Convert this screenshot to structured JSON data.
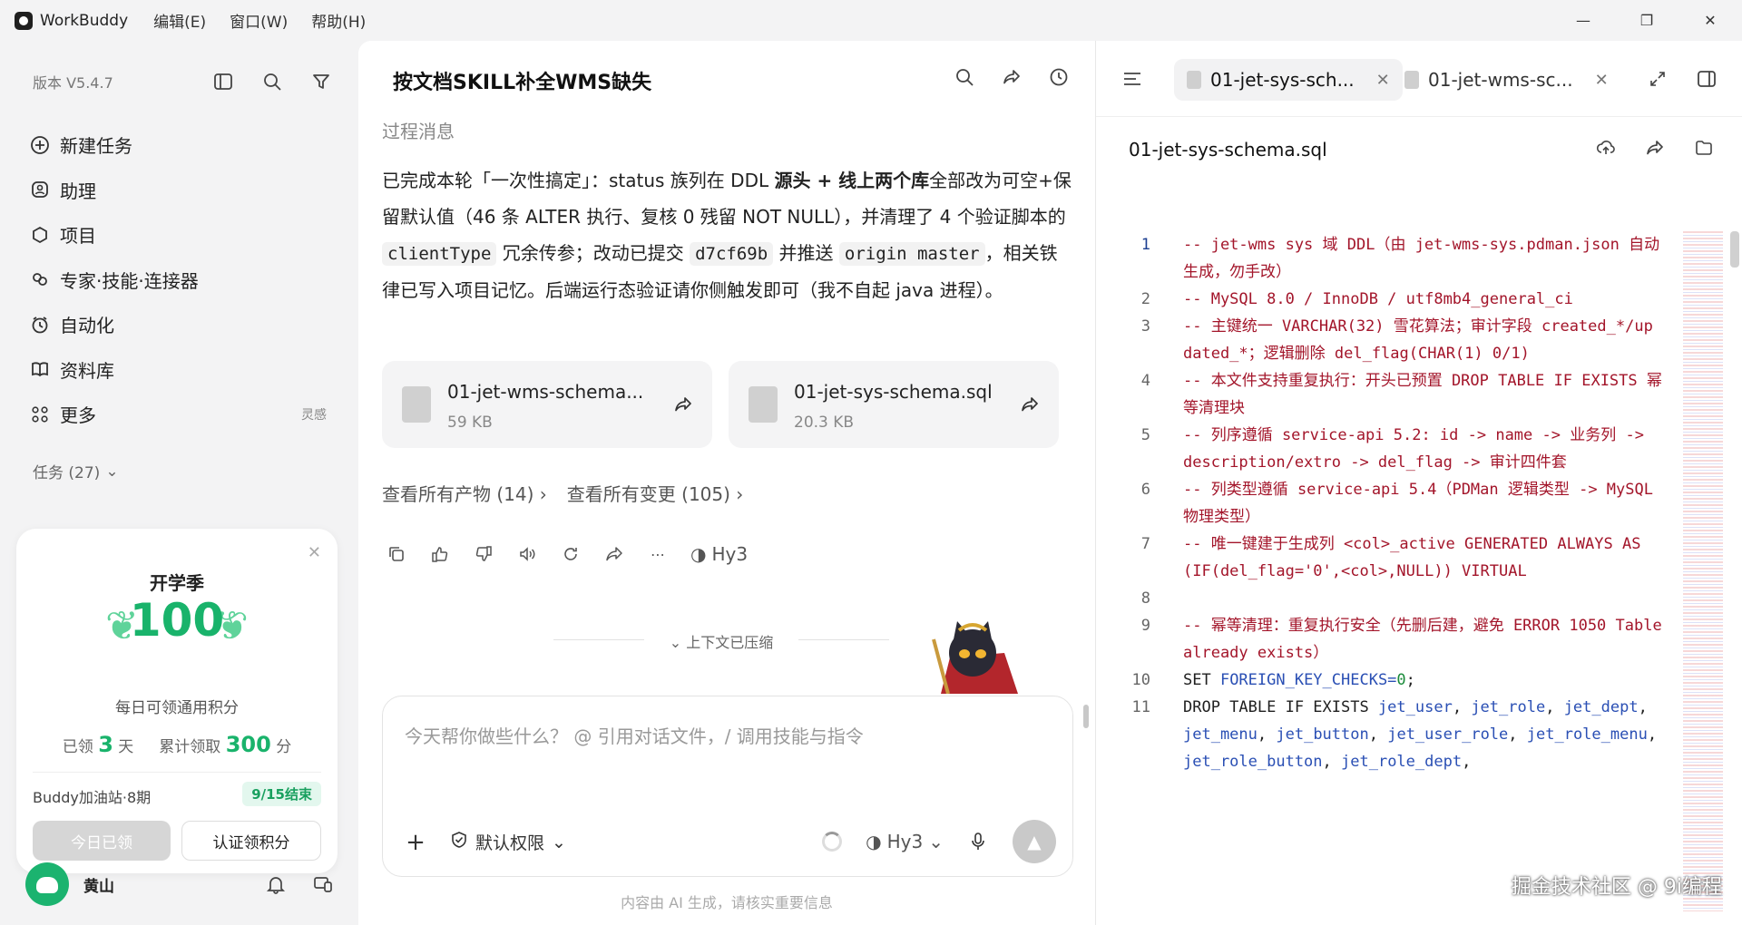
{
  "app": {
    "name": "WorkBuddy",
    "menu": [
      "编辑(E)",
      "窗口(W)",
      "帮助(H)"
    ]
  },
  "sidebar": {
    "version": "版本 V5.4.7",
    "items": [
      {
        "label": "新建任务",
        "icon": "new-task-icon"
      },
      {
        "label": "助理",
        "icon": "assistant-icon"
      },
      {
        "label": "项目",
        "icon": "project-icon"
      },
      {
        "label": "专家·技能·连接器",
        "icon": "expert-icon"
      },
      {
        "label": "自动化",
        "icon": "automation-icon"
      },
      {
        "label": "资料库",
        "icon": "library-icon"
      },
      {
        "label": "更多",
        "icon": "more-icon",
        "extra": "灵感"
      }
    ],
    "tasks_label": "任务 (27)"
  },
  "promo": {
    "title": "开学季",
    "points": "100",
    "subtitle": "每日可领通用积分",
    "claimed_prefix": "已领",
    "claimed_days": "3",
    "claimed_suffix": "天",
    "total_prefix": "累计领取",
    "total_points": "300",
    "total_suffix": "分",
    "station": "Buddy加油站·8期",
    "end_badge": "9/15结束",
    "today_button": "今日已领",
    "verify_button": "认证领积分"
  },
  "user": {
    "name": "黄山"
  },
  "chat": {
    "title": "按文档SKILL补全WMS缺失",
    "section_label": "过程消息",
    "message": {
      "p1": "已完成本轮「一次性搞定」：status 族列在 DDL ",
      "b1": "源头 + 线上两个库",
      "p2": "全部改为可空+保留默认值（46 条 ALTER 执行、复核 0 残留 NOT NULL），并清理了 4 个验证脚本的 ",
      "c1": "clientType",
      "p3": " 冗余传参；改动已提交 ",
      "c2": "d7cf69b",
      "p4": " 并推送 ",
      "c3": "origin master",
      "p5": "，相关铁律已写入项目记忆。后端运行态验证请你侧触发即可（我不自起 java 进程）。"
    },
    "files": [
      {
        "name": "01-jet-wms-schema...",
        "size": "59 KB"
      },
      {
        "name": "01-jet-sys-schema.sql",
        "size": "20.3 KB"
      }
    ],
    "view_artifacts": "查看所有产物 (14)",
    "view_changes": "查看所有变更 (105)",
    "model": "Hy3",
    "compressed": "上下文已压缩",
    "composer_placeholder": "今天帮你做些什么？ @ 引用对话文件，/ 调用技能与指令",
    "permission": "默认权限",
    "composer_model": "Hy3",
    "disclaimer": "内容由 AI 生成，请核实重要信息"
  },
  "viewer": {
    "tabs": [
      {
        "label": "01-jet-sys-sch...",
        "active": true
      },
      {
        "label": "01-jet-wms-sc...",
        "active": false
      }
    ],
    "file_title": "01-jet-sys-schema.sql",
    "code": [
      {
        "n": "1",
        "t": "-- jet-wms sys 域 DDL（由 jet-wms-sys.pdman.json 自动生成，勿手改）",
        "k": "cmt"
      },
      {
        "n": "2",
        "t": "-- MySQL 8.0 / InnoDB / utf8mb4_general_ci",
        "k": "cmt"
      },
      {
        "n": "3",
        "t": "-- 主键统一 VARCHAR(32) 雪花算法；审计字段 created_*/updated_*；逻辑删除 del_flag(CHAR(1) 0/1)",
        "k": "cmt"
      },
      {
        "n": "4",
        "t": "-- 本文件支持重复执行：开头已预置 DROP TABLE IF EXISTS 幂等清理块",
        "k": "cmt"
      },
      {
        "n": "5",
        "t": "-- 列序遵循 service-api 5.2: id -> name -> 业务列 -> description/extro -> del_flag -> 审计四件套",
        "k": "cmt"
      },
      {
        "n": "6",
        "t": "-- 列类型遵循 service-api 5.4（PDMan 逻辑类型 -> MySQL 物理类型）",
        "k": "cmt"
      },
      {
        "n": "7",
        "t": "-- 唯一键建于生成列 <col>_active GENERATED ALWAYS AS (IF(del_flag='0',<col>,NULL)) VIRTUAL",
        "k": "cmt"
      },
      {
        "n": "8",
        "t": "",
        "k": "kw"
      },
      {
        "n": "9",
        "t": "-- 幂等清理：重复执行安全（先删后建，避免 ERROR 1050 Table already exists）",
        "k": "cmt"
      },
      {
        "n": "10",
        "t": "SET FOREIGN_KEY_CHECKS=0;",
        "k": "set"
      },
      {
        "n": "11",
        "t": "DROP TABLE IF EXISTS jet_user, jet_role, jet_dept, jet_menu, jet_button, jet_user_role, jet_role_menu, jet_role_button, jet_role_dept,",
        "k": "drop"
      }
    ]
  },
  "watermark": "掘金技术社区 @ 9i编程"
}
